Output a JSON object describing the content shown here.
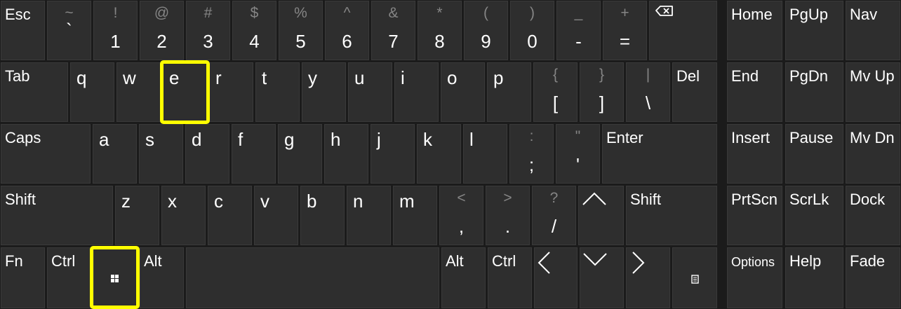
{
  "highlight_color": "#ffff00",
  "keys": {
    "esc": "Esc",
    "tilde": {
      "shift": "~",
      "base": "`"
    },
    "one": {
      "shift": "!",
      "base": "1"
    },
    "two": {
      "shift": "@",
      "base": "2"
    },
    "three": {
      "shift": "#",
      "base": "3"
    },
    "four": {
      "shift": "$",
      "base": "4"
    },
    "five": {
      "shift": "%",
      "base": "5"
    },
    "six": {
      "shift": "^",
      "base": "6"
    },
    "seven": {
      "shift": "&",
      "base": "7"
    },
    "eight": {
      "shift": "*",
      "base": "8"
    },
    "nine": {
      "shift": "(",
      "base": "9"
    },
    "zero": {
      "shift": ")",
      "base": "0"
    },
    "minus": {
      "shift": "_",
      "base": "-"
    },
    "equals": {
      "shift": "+",
      "base": "="
    },
    "backspace_icon": "backspace-icon",
    "home": "Home",
    "pgup": "PgUp",
    "nav": "Nav",
    "tab": "Tab",
    "q": "q",
    "w": "w",
    "e": "e",
    "r": "r",
    "t": "t",
    "y": "y",
    "u": "u",
    "i": "i",
    "o": "o",
    "p": "p",
    "lbracket": {
      "shift": "{",
      "base": "["
    },
    "rbracket": {
      "shift": "}",
      "base": "]"
    },
    "backslash": {
      "shift": "|",
      "base": "\\"
    },
    "del": "Del",
    "end": "End",
    "pgdn": "PgDn",
    "mvup": "Mv Up",
    "caps": "Caps",
    "a": "a",
    "s": "s",
    "d": "d",
    "f": "f",
    "g": "g",
    "h": "h",
    "j": "j",
    "k": "k",
    "l": "l",
    "semicolon": {
      "shift": ":",
      "base": ";"
    },
    "quote": {
      "shift": "\"",
      "base": "'"
    },
    "enter": "Enter",
    "insert": "Insert",
    "pause": "Pause",
    "mvdn": "Mv Dn",
    "shift": "Shift",
    "z": "z",
    "x": "x",
    "c": "c",
    "v": "v",
    "b": "b",
    "n": "n",
    "m": "m",
    "comma": {
      "shift": "<",
      "base": ","
    },
    "period": {
      "shift": ">",
      "base": "."
    },
    "slash": {
      "shift": "?",
      "base": "/"
    },
    "up_icon": "chevron-up-icon",
    "shift_right": "Shift",
    "prtscn": "PrtScn",
    "scrlk": "ScrLk",
    "dock": "Dock",
    "fn": "Fn",
    "ctrl": "Ctrl",
    "win_icon": "windows-logo-icon",
    "alt": "Alt",
    "alt_right": "Alt",
    "ctrl_right": "Ctrl",
    "left_icon": "chevron-left-icon",
    "down_icon": "chevron-down-icon",
    "right_icon": "chevron-right-icon",
    "menu_icon": "context-menu-icon",
    "options": "Options",
    "help": "Help",
    "fade": "Fade"
  }
}
